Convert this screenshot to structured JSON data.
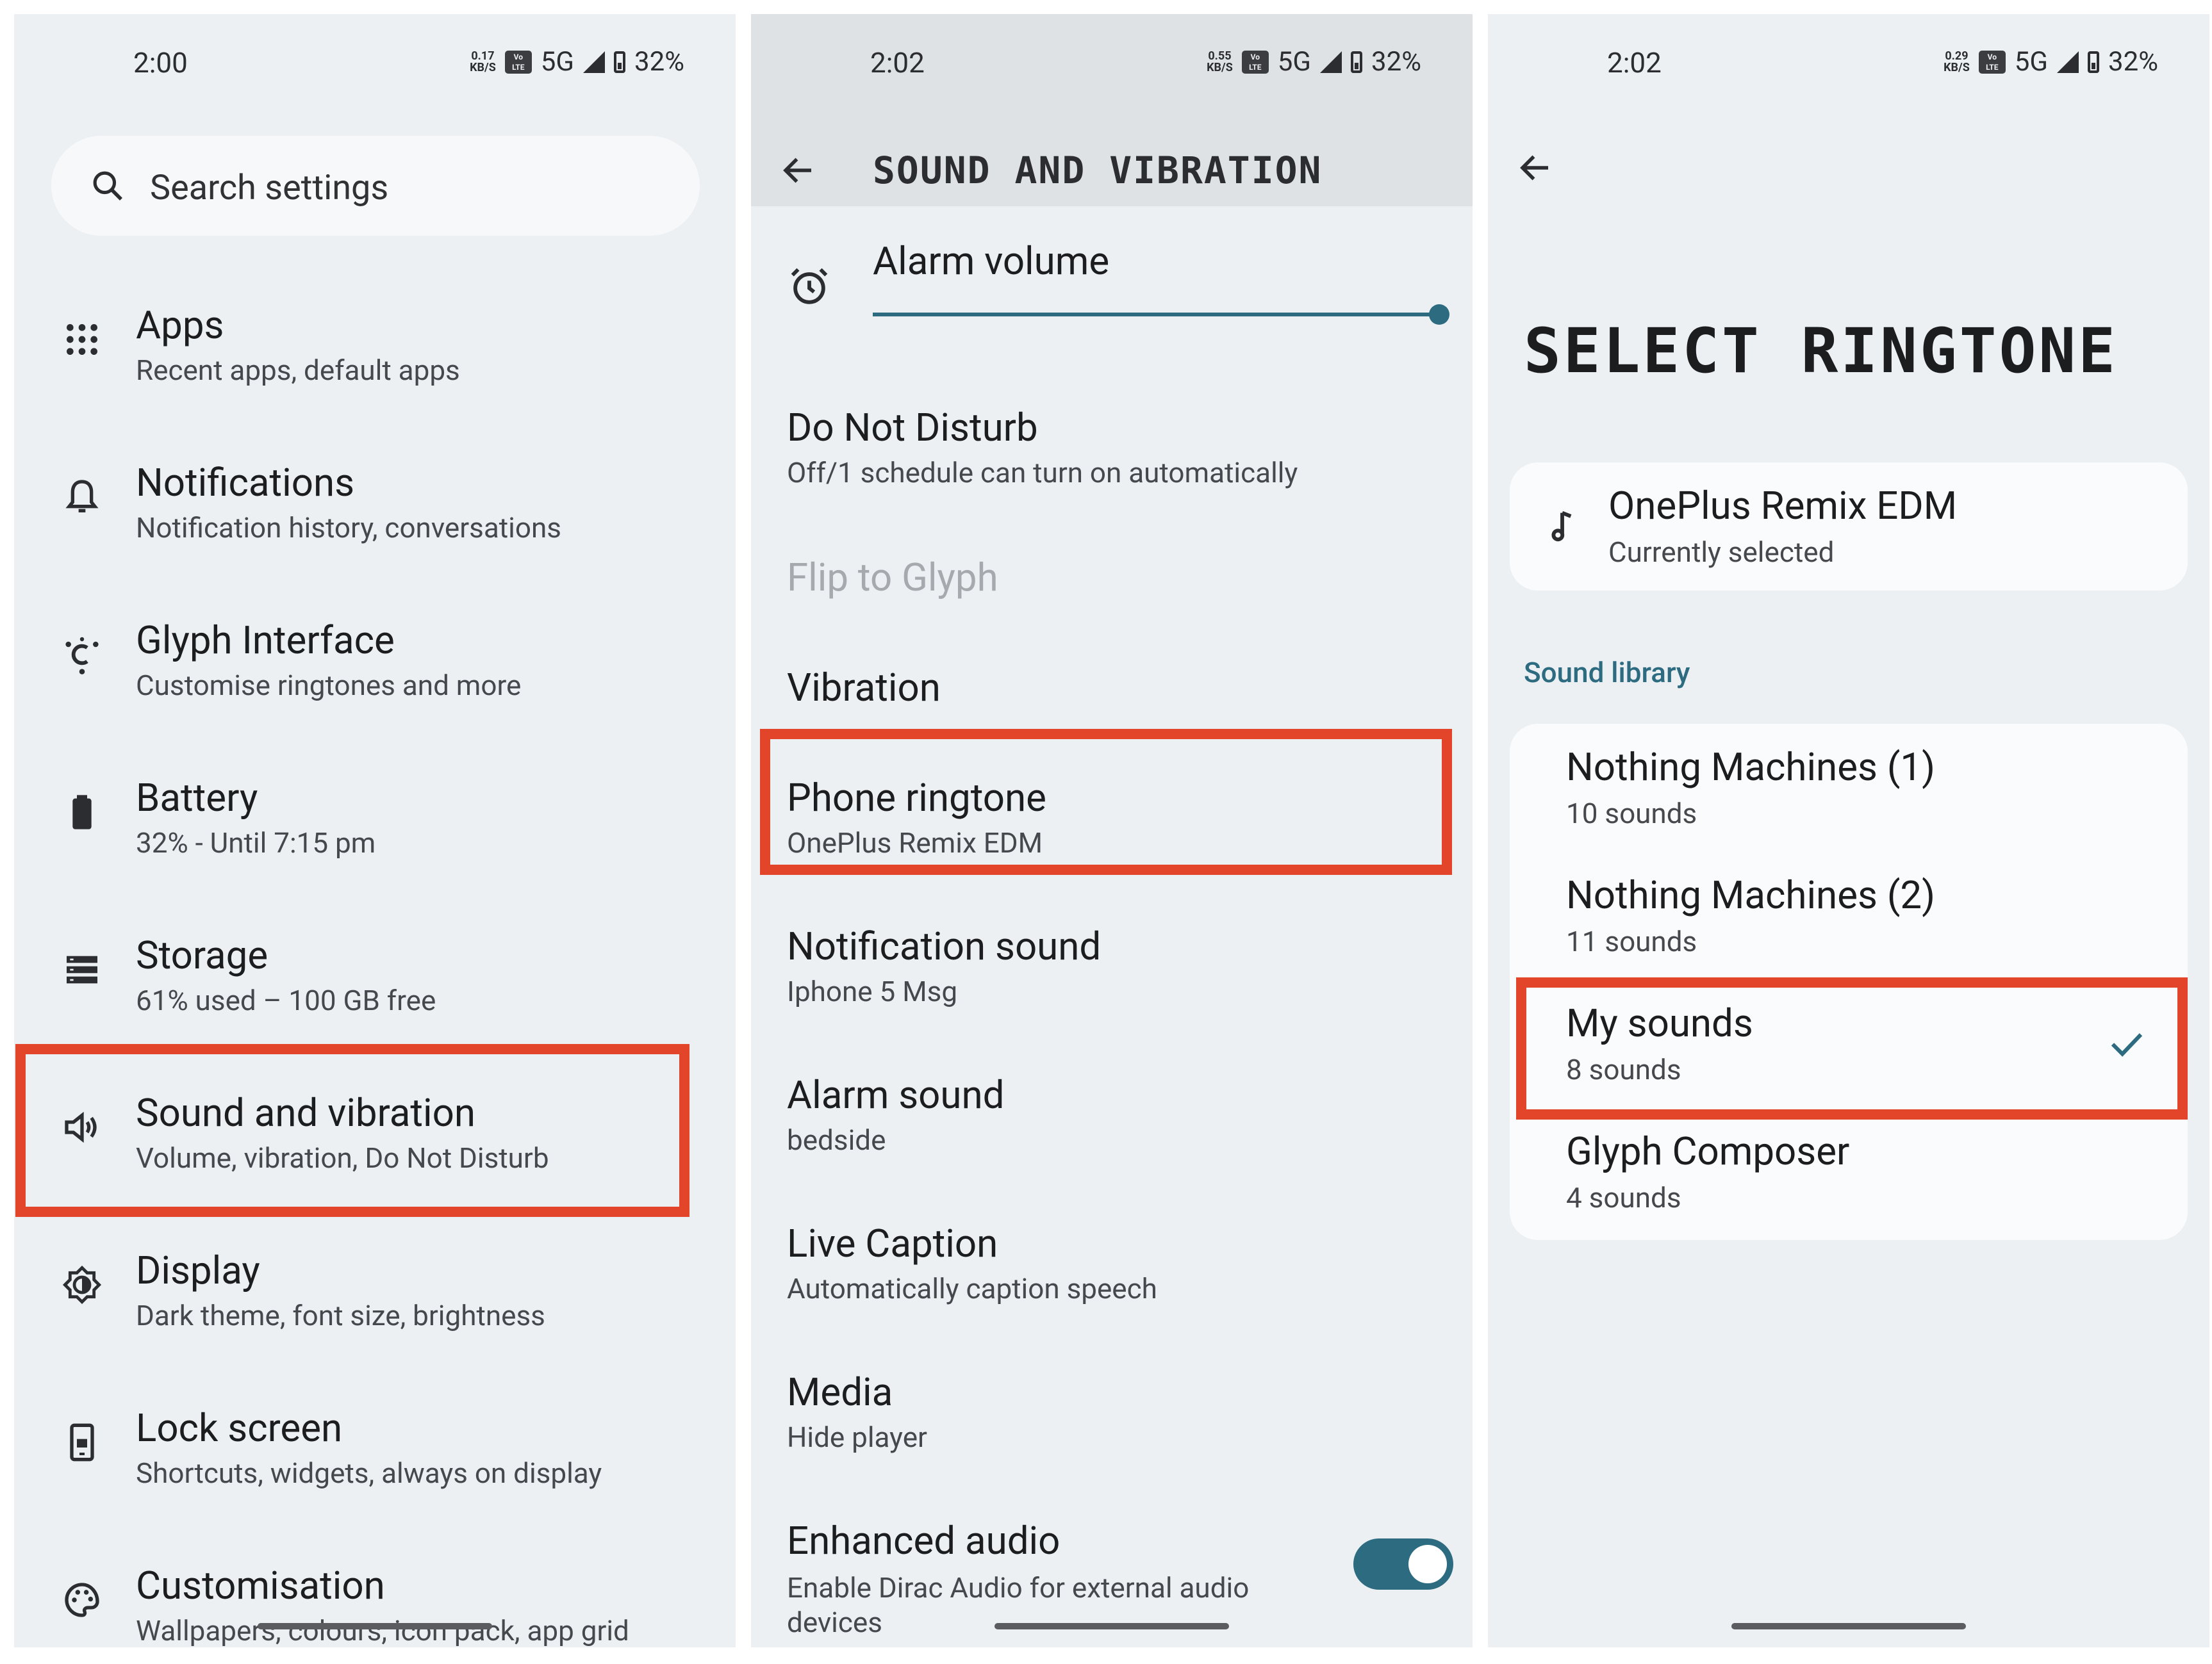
{
  "status_bar": [
    {
      "time": "2:00",
      "speed": "0.17\nKB/S",
      "volte": "Vo\nLTE",
      "network": "5G",
      "battery": "32%"
    },
    {
      "time": "2:02",
      "speed": "0.55\nKB/S",
      "volte": "Vo\nLTE",
      "network": "5G",
      "battery": "32%"
    },
    {
      "time": "2:02",
      "speed": "0.29\nKB/S",
      "volte": "Vo\nLTE",
      "network": "5G",
      "battery": "32%"
    }
  ],
  "settings": {
    "search_placeholder": "Search settings",
    "items": [
      {
        "title": "Apps",
        "subtitle": "Recent apps, default apps",
        "icon": "apps-grid-icon"
      },
      {
        "title": "Notifications",
        "subtitle": "Notification history, conversations",
        "icon": "bell-icon"
      },
      {
        "title": "Glyph Interface",
        "subtitle": "Customise ringtones and more",
        "icon": "glyph-icon"
      },
      {
        "title": "Battery",
        "subtitle": "32% - Until 7:15 pm",
        "icon": "battery-icon"
      },
      {
        "title": "Storage",
        "subtitle": "61% used – 100 GB free",
        "icon": "storage-icon"
      },
      {
        "title": "Sound and vibration",
        "subtitle": "Volume, vibration, Do Not Disturb",
        "icon": "speaker-icon"
      },
      {
        "title": "Display",
        "subtitle": "Dark theme, font size, brightness",
        "icon": "brightness-icon"
      },
      {
        "title": "Lock screen",
        "subtitle": "Shortcuts, widgets, always on display",
        "icon": "phone-lock-icon"
      },
      {
        "title": "Customisation",
        "subtitle": "Wallpapers, colours, icon pack, app grid",
        "icon": "palette-icon"
      }
    ]
  },
  "sound": {
    "header_title": "SOUND AND VIBRATION",
    "alarm_volume_label": "Alarm volume",
    "alarm_volume_level": 1.0,
    "items": [
      {
        "title": "Do Not Disturb",
        "subtitle": "Off/1 schedule can turn on automatically"
      },
      {
        "title": "Flip to Glyph",
        "subtitle": ""
      },
      {
        "title": "Vibration",
        "subtitle": ""
      },
      {
        "title": "Phone ringtone",
        "subtitle": "OnePlus Remix EDM"
      },
      {
        "title": "Notification sound",
        "subtitle": "Iphone 5 Msg"
      },
      {
        "title": "Alarm sound",
        "subtitle": "bedside"
      },
      {
        "title": "Live Caption",
        "subtitle": "Automatically caption speech"
      },
      {
        "title": "Media",
        "subtitle": "Hide player"
      },
      {
        "title": "Enhanced audio",
        "subtitle": "Enable Dirac Audio for external audio devices"
      }
    ],
    "enhanced_audio_on": true
  },
  "ringtone": {
    "title": "SELECT RINGTONE",
    "current": {
      "title": "OnePlus Remix EDM",
      "subtitle": "Currently selected"
    },
    "library_label": "Sound library",
    "library": [
      {
        "title": "Nothing Machines (1)",
        "subtitle": "10 sounds"
      },
      {
        "title": "Nothing Machines (2)",
        "subtitle": "11 sounds"
      },
      {
        "title": "My sounds",
        "subtitle": "8 sounds"
      },
      {
        "title": "Glyph Composer",
        "subtitle": "4 sounds"
      }
    ]
  },
  "colors": {
    "accent": "#2c6b80",
    "highlight": "#e24529",
    "background": "#edf0f3"
  }
}
